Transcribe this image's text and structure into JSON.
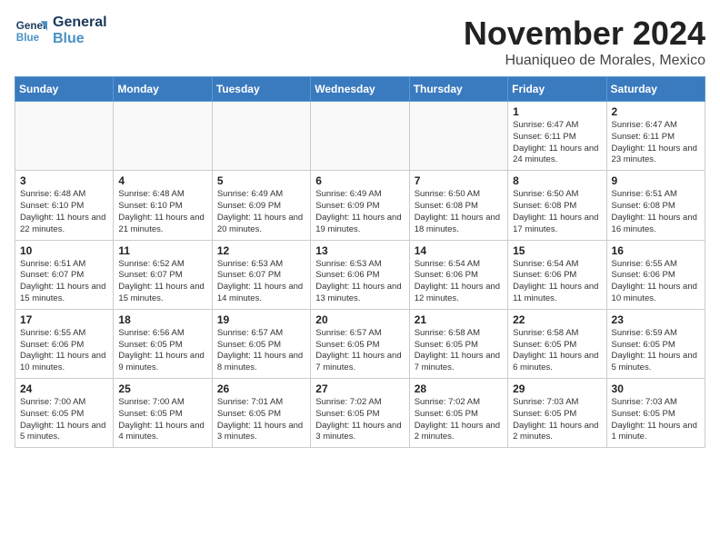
{
  "logo": {
    "line1": "General",
    "line2": "Blue"
  },
  "title": "November 2024",
  "subtitle": "Huaniqueo de Morales, Mexico",
  "weekdays": [
    "Sunday",
    "Monday",
    "Tuesday",
    "Wednesday",
    "Thursday",
    "Friday",
    "Saturday"
  ],
  "weeks": [
    [
      {
        "day": "",
        "info": ""
      },
      {
        "day": "",
        "info": ""
      },
      {
        "day": "",
        "info": ""
      },
      {
        "day": "",
        "info": ""
      },
      {
        "day": "",
        "info": ""
      },
      {
        "day": "1",
        "info": "Sunrise: 6:47 AM\nSunset: 6:11 PM\nDaylight: 11 hours and 24 minutes."
      },
      {
        "day": "2",
        "info": "Sunrise: 6:47 AM\nSunset: 6:11 PM\nDaylight: 11 hours and 23 minutes."
      }
    ],
    [
      {
        "day": "3",
        "info": "Sunrise: 6:48 AM\nSunset: 6:10 PM\nDaylight: 11 hours and 22 minutes."
      },
      {
        "day": "4",
        "info": "Sunrise: 6:48 AM\nSunset: 6:10 PM\nDaylight: 11 hours and 21 minutes."
      },
      {
        "day": "5",
        "info": "Sunrise: 6:49 AM\nSunset: 6:09 PM\nDaylight: 11 hours and 20 minutes."
      },
      {
        "day": "6",
        "info": "Sunrise: 6:49 AM\nSunset: 6:09 PM\nDaylight: 11 hours and 19 minutes."
      },
      {
        "day": "7",
        "info": "Sunrise: 6:50 AM\nSunset: 6:08 PM\nDaylight: 11 hours and 18 minutes."
      },
      {
        "day": "8",
        "info": "Sunrise: 6:50 AM\nSunset: 6:08 PM\nDaylight: 11 hours and 17 minutes."
      },
      {
        "day": "9",
        "info": "Sunrise: 6:51 AM\nSunset: 6:08 PM\nDaylight: 11 hours and 16 minutes."
      }
    ],
    [
      {
        "day": "10",
        "info": "Sunrise: 6:51 AM\nSunset: 6:07 PM\nDaylight: 11 hours and 15 minutes."
      },
      {
        "day": "11",
        "info": "Sunrise: 6:52 AM\nSunset: 6:07 PM\nDaylight: 11 hours and 15 minutes."
      },
      {
        "day": "12",
        "info": "Sunrise: 6:53 AM\nSunset: 6:07 PM\nDaylight: 11 hours and 14 minutes."
      },
      {
        "day": "13",
        "info": "Sunrise: 6:53 AM\nSunset: 6:06 PM\nDaylight: 11 hours and 13 minutes."
      },
      {
        "day": "14",
        "info": "Sunrise: 6:54 AM\nSunset: 6:06 PM\nDaylight: 11 hours and 12 minutes."
      },
      {
        "day": "15",
        "info": "Sunrise: 6:54 AM\nSunset: 6:06 PM\nDaylight: 11 hours and 11 minutes."
      },
      {
        "day": "16",
        "info": "Sunrise: 6:55 AM\nSunset: 6:06 PM\nDaylight: 11 hours and 10 minutes."
      }
    ],
    [
      {
        "day": "17",
        "info": "Sunrise: 6:55 AM\nSunset: 6:06 PM\nDaylight: 11 hours and 10 minutes."
      },
      {
        "day": "18",
        "info": "Sunrise: 6:56 AM\nSunset: 6:05 PM\nDaylight: 11 hours and 9 minutes."
      },
      {
        "day": "19",
        "info": "Sunrise: 6:57 AM\nSunset: 6:05 PM\nDaylight: 11 hours and 8 minutes."
      },
      {
        "day": "20",
        "info": "Sunrise: 6:57 AM\nSunset: 6:05 PM\nDaylight: 11 hours and 7 minutes."
      },
      {
        "day": "21",
        "info": "Sunrise: 6:58 AM\nSunset: 6:05 PM\nDaylight: 11 hours and 7 minutes."
      },
      {
        "day": "22",
        "info": "Sunrise: 6:58 AM\nSunset: 6:05 PM\nDaylight: 11 hours and 6 minutes."
      },
      {
        "day": "23",
        "info": "Sunrise: 6:59 AM\nSunset: 6:05 PM\nDaylight: 11 hours and 5 minutes."
      }
    ],
    [
      {
        "day": "24",
        "info": "Sunrise: 7:00 AM\nSunset: 6:05 PM\nDaylight: 11 hours and 5 minutes."
      },
      {
        "day": "25",
        "info": "Sunrise: 7:00 AM\nSunset: 6:05 PM\nDaylight: 11 hours and 4 minutes."
      },
      {
        "day": "26",
        "info": "Sunrise: 7:01 AM\nSunset: 6:05 PM\nDaylight: 11 hours and 3 minutes."
      },
      {
        "day": "27",
        "info": "Sunrise: 7:02 AM\nSunset: 6:05 PM\nDaylight: 11 hours and 3 minutes."
      },
      {
        "day": "28",
        "info": "Sunrise: 7:02 AM\nSunset: 6:05 PM\nDaylight: 11 hours and 2 minutes."
      },
      {
        "day": "29",
        "info": "Sunrise: 7:03 AM\nSunset: 6:05 PM\nDaylight: 11 hours and 2 minutes."
      },
      {
        "day": "30",
        "info": "Sunrise: 7:03 AM\nSunset: 6:05 PM\nDaylight: 11 hours and 1 minute."
      }
    ]
  ]
}
